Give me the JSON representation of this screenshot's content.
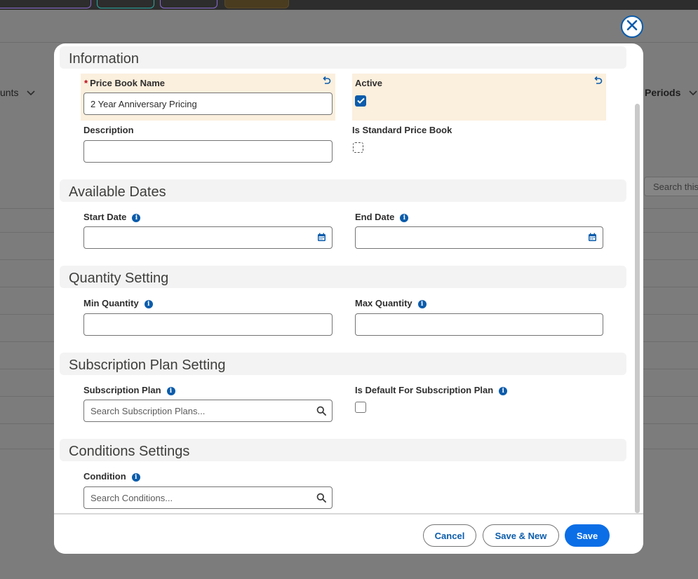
{
  "background": {
    "nav_left_label": "unts",
    "nav_right_label": "Periods",
    "search_placeholder": "Search this"
  },
  "modal": {
    "sections": {
      "information": "Information",
      "available_dates": "Available Dates",
      "quantity_setting": "Quantity Setting",
      "subscription_plan_setting": "Subscription Plan Setting",
      "conditions_settings": "Conditions Settings"
    },
    "fields": {
      "price_book_name": {
        "label": "Price Book Name",
        "value": "2 Year Anniversary Pricing",
        "required_marker": "*"
      },
      "active": {
        "label": "Active",
        "checked": true
      },
      "description": {
        "label": "Description",
        "value": ""
      },
      "is_standard_price_book": {
        "label": "Is Standard Price Book",
        "checked": false
      },
      "start_date": {
        "label": "Start Date",
        "value": ""
      },
      "end_date": {
        "label": "End Date",
        "value": ""
      },
      "min_quantity": {
        "label": "Min Quantity",
        "value": ""
      },
      "max_quantity": {
        "label": "Max Quantity",
        "value": ""
      },
      "subscription_plan": {
        "label": "Subscription Plan",
        "placeholder": "Search Subscription Plans..."
      },
      "is_default_for_subscription_plan": {
        "label": "Is Default For Subscription Plan",
        "checked": false
      },
      "condition": {
        "label": "Condition",
        "placeholder": "Search Conditions..."
      }
    },
    "footer": {
      "cancel_label": "Cancel",
      "save_new_label": "Save & New",
      "save_label": "Save"
    }
  },
  "colors": {
    "brand": "#0b6ee6",
    "info_icon": "#0b5cab",
    "edited_field_highlight": "#fbefdd",
    "required": "#ba0517"
  },
  "icons": [
    "close-icon",
    "undo-icon",
    "info-icon",
    "calendar-icon",
    "search-icon",
    "checkmark-icon",
    "chevron-down-icon"
  ]
}
